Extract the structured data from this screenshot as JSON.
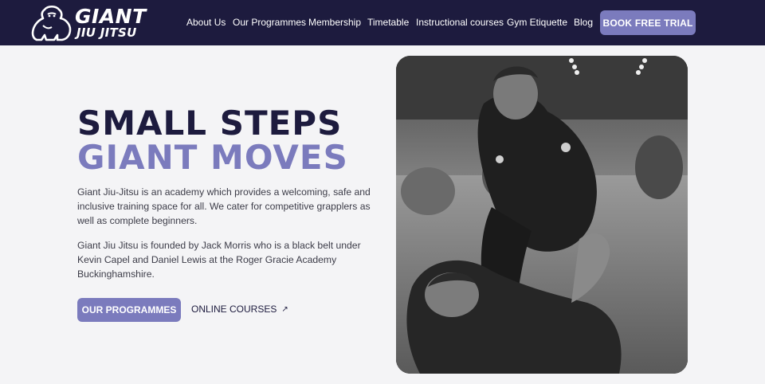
{
  "brand": {
    "name_line1": "GIANT",
    "name_line2": "JIU JITSU"
  },
  "nav": {
    "items": [
      {
        "label": "About Us"
      },
      {
        "label": "Our Programmes"
      },
      {
        "label": "Membership"
      },
      {
        "label": "Timetable"
      },
      {
        "label": "Instructional courses"
      },
      {
        "label": "Gym Etiquette"
      },
      {
        "label": "Blog"
      }
    ],
    "cta_label": "BOOK FREE TRIAL"
  },
  "hero": {
    "headline_line1": "SMALL STEPS",
    "headline_line2": "GIANT MOVES",
    "paragraph1": "Giant Jiu-Jitsu is an academy which provides a welcoming, safe and inclusive training space for all. We cater for competitive grapplers as well as complete beginners.",
    "paragraph2": "Giant Jiu Jitsu is founded by Jack Morris who is a black belt under Kevin Capel and Daniel Lewis at the Roger Gracie Academy Buckinghamshire.",
    "primary_button": "OUR PROGRAMMES",
    "secondary_link": "ONLINE COURSES",
    "secondary_icon": "arrow-up-right-icon"
  },
  "colors": {
    "navy": "#1d1b3e",
    "accent": "#7b7bbd",
    "background": "#f4f4f6"
  }
}
